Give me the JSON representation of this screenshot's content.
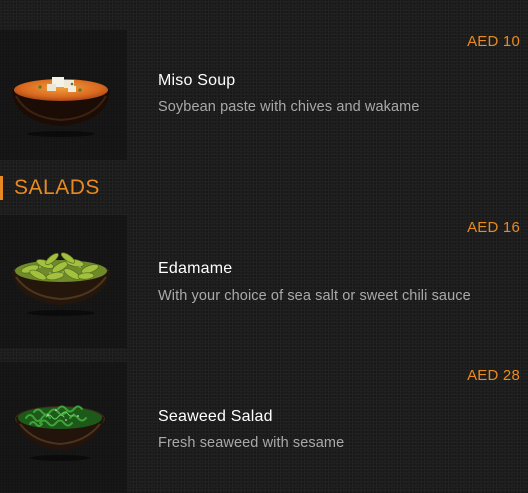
{
  "sections": [
    {
      "items": [
        {
          "name": "Miso Soup",
          "description": "Soybean paste with chives and wakame",
          "price": "AED 10",
          "image_icon": "miso-soup-bowl-image"
        }
      ]
    },
    {
      "heading": "SALADS",
      "items": [
        {
          "name": "Edamame",
          "description": "With your choice of sea salt or sweet chili sauce",
          "price": "AED 16",
          "image_icon": "edamame-bowl-image"
        },
        {
          "name": "Seaweed Salad",
          "description": "Fresh seaweed with sesame",
          "price": "AED 28",
          "image_icon": "seaweed-salad-bowl-image"
        }
      ]
    }
  ],
  "colors": {
    "accent": "#e88a22",
    "background": "#1c1c1c",
    "name_text": "#ffffff",
    "description_text": "#a9a9a9"
  }
}
